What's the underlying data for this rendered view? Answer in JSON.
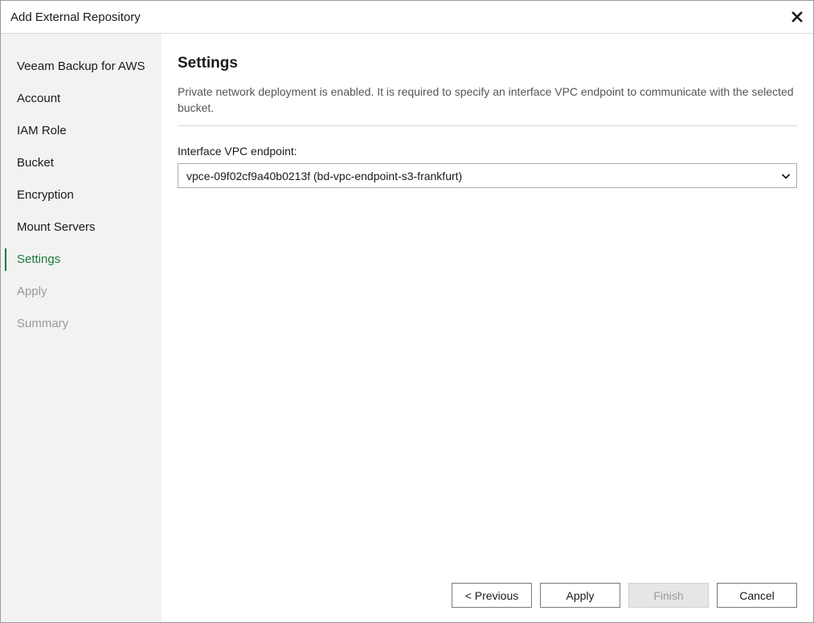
{
  "window": {
    "title": "Add External Repository"
  },
  "sidebar": {
    "items": [
      {
        "label": "Veeam Backup for AWS",
        "state": "normal"
      },
      {
        "label": "Account",
        "state": "normal"
      },
      {
        "label": "IAM Role",
        "state": "normal"
      },
      {
        "label": "Bucket",
        "state": "normal"
      },
      {
        "label": "Encryption",
        "state": "normal"
      },
      {
        "label": "Mount Servers",
        "state": "normal"
      },
      {
        "label": "Settings",
        "state": "active"
      },
      {
        "label": "Apply",
        "state": "disabled"
      },
      {
        "label": "Summary",
        "state": "disabled"
      }
    ]
  },
  "main": {
    "title": "Settings",
    "description": "Private network deployment is enabled. It is required to specify an interface VPC endpoint to communicate with the selected bucket.",
    "vpc_endpoint": {
      "label": "Interface VPC endpoint:",
      "selected": "vpce-09f02cf9a40b0213f (bd-vpc-endpoint-s3-frankfurt)"
    }
  },
  "footer": {
    "previous_label": "< Previous",
    "apply_label": "Apply",
    "finish_label": "Finish",
    "cancel_label": "Cancel"
  },
  "colors": {
    "accent": "#1a7a3c",
    "sidebar_bg": "#f2f2f2",
    "disabled_text": "#9a9a9a"
  },
  "icons": {
    "close": "close-icon",
    "dropdown": "chevron-down-icon"
  }
}
